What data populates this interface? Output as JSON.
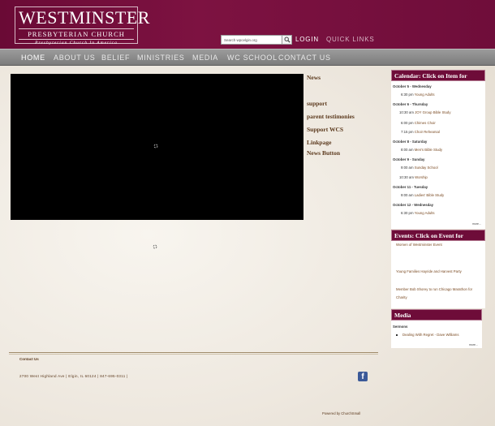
{
  "header": {
    "logo_name": "WESTMINSTER",
    "logo_sub": "PRESBYTERIAN CHURCH",
    "logo_tag": "Presbyterian Church In America",
    "search_placeholder": "Search wpcelgin.org",
    "login": "LOGIN",
    "quick_links": "QUICK LINKS"
  },
  "nav": {
    "items": [
      {
        "label": "HOME"
      },
      {
        "label": "ABOUT US"
      },
      {
        "label": "BELIEF"
      },
      {
        "label": "MINISTRIES"
      },
      {
        "label": "MEDIA"
      },
      {
        "label": "WC SCHOOL"
      },
      {
        "label": "CONTACT US"
      }
    ]
  },
  "side_links": {
    "items": [
      "News",
      "support",
      "parent testimonies",
      "Support WCS",
      "Linkpage",
      "News Button"
    ]
  },
  "calendar": {
    "title": "Calendar: Click on Item for Details",
    "days": [
      {
        "day": "October 5 - Wednesday",
        "events": [
          {
            "time": "6:30 pm",
            "name": "Young Adults"
          }
        ]
      },
      {
        "day": "October 6 - Thursday",
        "events": [
          {
            "time": "10:30 am",
            "name": "JOY Group Bible Study"
          },
          {
            "time": "6:00 pm",
            "name": "Chimes Choir"
          },
          {
            "time": "7:15 pm",
            "name": "Choir Rehearsal"
          }
        ]
      },
      {
        "day": "October 8 - Saturday",
        "events": [
          {
            "time": "8:00 am",
            "name": "Men's Bible Study"
          }
        ]
      },
      {
        "day": "October 9 - Sunday",
        "events": [
          {
            "time": "9:00 am",
            "name": "Sunday School"
          },
          {
            "time": "10:30 am",
            "name": "Worship"
          }
        ]
      },
      {
        "day": "October 11 - Tuesday",
        "events": [
          {
            "time": "9:00 am",
            "name": "Ladies' Bible Study"
          }
        ]
      },
      {
        "day": "October 12 - Wednesday",
        "events": [
          {
            "time": "6:30 pm",
            "name": "Young Adults"
          }
        ]
      }
    ],
    "more": "more..."
  },
  "events": {
    "title": "Events: Click on Event for Details",
    "items": [
      "Women of Westminster Event",
      "Young Families Hayride and Harvest Party",
      "Member Bob Shorey to run Chicago Marathon for Charity"
    ]
  },
  "media": {
    "title": "Media",
    "label": "Sermons",
    "items": [
      "Dealing With Regret - Dave Williams"
    ],
    "more": "more..."
  },
  "footer": {
    "contact_label": "Contact Us",
    "address": "2700 West Highland Ave | Elgin, IL 60124 | 847-695-0311 |",
    "powered": "Powered by ChurchSmall"
  },
  "colors": {
    "brand": "#6e0c39",
    "nav": "#8a8a8a",
    "link": "#5c3a1e"
  }
}
